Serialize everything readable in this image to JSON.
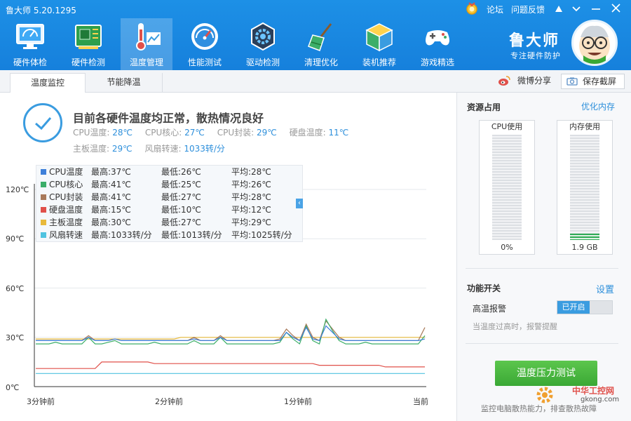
{
  "app": {
    "title": "鲁大师 5.20.1295",
    "forum_label": "论坛",
    "feedback_label": "问题反馈",
    "brand_name": "鲁大师",
    "brand_slogan": "专注硬件防护"
  },
  "nav": {
    "items": [
      {
        "label": "硬件体检",
        "icon": "monitor-check-icon"
      },
      {
        "label": "硬件检测",
        "icon": "circuit-board-icon"
      },
      {
        "label": "温度管理",
        "icon": "thermometer-icon",
        "active": true
      },
      {
        "label": "性能测试",
        "icon": "speedometer-icon"
      },
      {
        "label": "驱动检测",
        "icon": "gear-box-icon"
      },
      {
        "label": "清理优化",
        "icon": "broom-icon"
      },
      {
        "label": "装机推荐",
        "icon": "cube-icon"
      },
      {
        "label": "游戏精选",
        "icon": "gamepad-icon"
      }
    ]
  },
  "tabs": [
    {
      "label": "温度监控",
      "active": true
    },
    {
      "label": "节能降温",
      "active": false
    }
  ],
  "toolbar": {
    "share_label": "微博分享",
    "screenshot_label": "保存截屏"
  },
  "status": {
    "title": "目前各硬件温度均正常，散热情况良好",
    "row1": [
      {
        "label": "CPU温度:",
        "value": "28℃"
      },
      {
        "label": "CPU核心:",
        "value": "27℃"
      },
      {
        "label": "CPU封装:",
        "value": "29℃"
      },
      {
        "label": "硬盘温度:",
        "value": "11℃"
      }
    ],
    "row2": [
      {
        "label": "主板温度:",
        "value": "29℃"
      },
      {
        "label": "风扇转速:",
        "value": "1033转/分"
      }
    ]
  },
  "legend": [
    {
      "name": "CPU温度",
      "high": "最高:37℃",
      "low": "最低:26℃",
      "avg": "平均:28℃",
      "color": "#3d7fd9"
    },
    {
      "name": "CPU核心",
      "high": "最高:41℃",
      "low": "最低:25℃",
      "avg": "平均:26℃",
      "color": "#3cae69"
    },
    {
      "name": "CPU封装",
      "high": "最高:41℃",
      "low": "最低:27℃",
      "avg": "平均:28℃",
      "color": "#a8795a"
    },
    {
      "name": "硬盘温度",
      "high": "最高:15℃",
      "low": "最低:10℃",
      "avg": "平均:12℃",
      "color": "#e0504a"
    },
    {
      "name": "主板温度",
      "high": "最高:30℃",
      "low": "最低:27℃",
      "avg": "平均:29℃",
      "color": "#e8b93a"
    },
    {
      "name": "风扇转速",
      "high": "最高:1033转/分",
      "low": "最低:1013转/分",
      "avg": "平均:1025转/分",
      "color": "#4fc3e0"
    }
  ],
  "right_panel": {
    "resources_title": "资源占用",
    "optimize_label": "优化内存",
    "cpu_title": "CPU使用",
    "cpu_value": "0%",
    "cpu_level": 0,
    "mem_title": "内存使用",
    "mem_value": "1.9 GB",
    "mem_level": 0.06,
    "func_title": "功能开关",
    "settings_label": "设置",
    "alarm_label": "高温报警",
    "alarm_toggle": "已开启",
    "alarm_desc": "当温度过高时，报警提醒",
    "stress_label": "温度压力测试",
    "stress_desc": "监控电脑散热能力，排查散热故障"
  },
  "watermark": {
    "name": "中华工控网",
    "site": "gkong.com"
  },
  "chart_data": {
    "type": "line",
    "y_ticks": [
      "120℃",
      "90℃",
      "60℃",
      "30℃",
      "0℃"
    ],
    "ylim": [
      0,
      120
    ],
    "x_ticks": [
      "3分钟前",
      "2分钟前",
      "1分钟前",
      "当前"
    ],
    "grid": true,
    "legend_position": "top-left",
    "series": [
      {
        "name": "CPU温度",
        "color": "#3d7fd9",
        "values": [
          28,
          28,
          28,
          28,
          28,
          28,
          28,
          28,
          30,
          28,
          28,
          28,
          29,
          28,
          28,
          28,
          28,
          28,
          28,
          28,
          28,
          28,
          28,
          28,
          29,
          28,
          28,
          28,
          30,
          28,
          28,
          28,
          28,
          28,
          28,
          28,
          28,
          28,
          33,
          30,
          28,
          36,
          29,
          28,
          37,
          33,
          29,
          28,
          28,
          28,
          28,
          28,
          28,
          28,
          28,
          28,
          28,
          28,
          28,
          29
        ]
      },
      {
        "name": "CPU核心",
        "color": "#3cae69",
        "values": [
          26,
          26,
          26,
          27,
          26,
          26,
          26,
          26,
          30,
          26,
          26,
          27,
          28,
          26,
          26,
          26,
          26,
          26,
          27,
          26,
          26,
          26,
          26,
          26,
          28,
          26,
          26,
          26,
          30,
          26,
          26,
          26,
          26,
          26,
          26,
          26,
          26,
          27,
          33,
          29,
          26,
          37,
          28,
          26,
          41,
          34,
          28,
          26,
          26,
          26,
          27,
          26,
          26,
          26,
          26,
          26,
          26,
          26,
          26,
          31
        ]
      },
      {
        "name": "CPU封装",
        "color": "#a8795a",
        "values": [
          28,
          28,
          28,
          28,
          28,
          28,
          28,
          28,
          31,
          28,
          28,
          28,
          29,
          28,
          28,
          28,
          28,
          28,
          28,
          28,
          28,
          28,
          28,
          28,
          30,
          28,
          28,
          28,
          31,
          28,
          28,
          28,
          28,
          28,
          28,
          28,
          28,
          29,
          35,
          31,
          28,
          38,
          30,
          28,
          40,
          35,
          30,
          28,
          28,
          28,
          28,
          28,
          28,
          28,
          28,
          28,
          28,
          28,
          28,
          36
        ]
      },
      {
        "name": "硬盘温度",
        "color": "#e0504a",
        "values": [
          11,
          11,
          11,
          11,
          11,
          11,
          11,
          11,
          11,
          11,
          15,
          15,
          15,
          15,
          15,
          15,
          15,
          15,
          14,
          14,
          14,
          14,
          14,
          14,
          14,
          14,
          14,
          14,
          14,
          14,
          14,
          14,
          14,
          14,
          14,
          14,
          14,
          14,
          14,
          14,
          14,
          14,
          14,
          13,
          13,
          13,
          13,
          13,
          13,
          13,
          13,
          13,
          13,
          12,
          12,
          12,
          12,
          12,
          12,
          12
        ]
      },
      {
        "name": "主板温度",
        "color": "#e8b93a",
        "values": [
          29,
          29,
          29,
          29,
          29,
          29,
          29,
          29,
          29,
          29,
          29,
          29,
          29,
          29,
          29,
          29,
          29,
          29,
          29,
          29,
          29,
          29,
          30,
          30,
          30,
          30,
          30,
          30,
          30,
          30,
          30,
          30,
          30,
          30,
          30,
          30,
          30,
          30,
          30,
          30,
          30,
          30,
          30,
          30,
          30,
          30,
          30,
          30,
          30,
          30,
          30,
          30,
          30,
          30,
          30,
          30,
          30,
          30,
          30,
          30
        ]
      },
      {
        "name": "风扇转速",
        "color": "#4fc3e0",
        "values": [
          8,
          8,
          8,
          8,
          8,
          8,
          8,
          8,
          8,
          8,
          8,
          8,
          8,
          8,
          8,
          8,
          8,
          8,
          8,
          8,
          8,
          8,
          8,
          8,
          8,
          8,
          8,
          8,
          8,
          8,
          8,
          8,
          8,
          8,
          8,
          8,
          8,
          8,
          8,
          8,
          8,
          8,
          8,
          8,
          8,
          8,
          8,
          8,
          8,
          8,
          8,
          8,
          8,
          8,
          8,
          8,
          8,
          8,
          8,
          8
        ]
      }
    ]
  }
}
